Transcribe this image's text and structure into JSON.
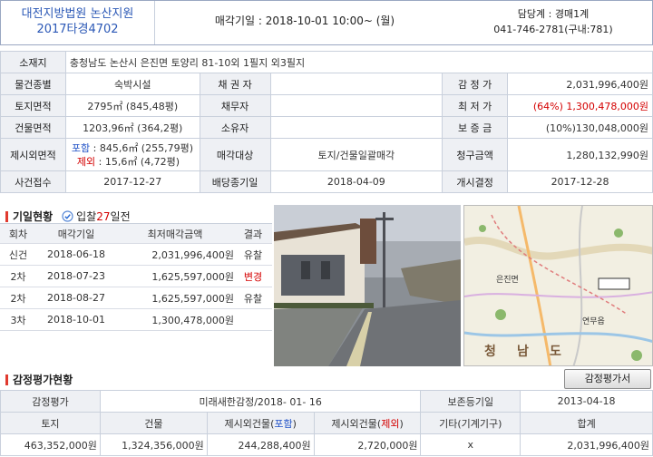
{
  "header": {
    "court": "대전지방법원 논산지원",
    "case_no": "2017타경4702",
    "sale_date": "매각기일 : 2018-10-01   10:00~ (월)",
    "dept": "담당계 : 경매1계",
    "phone": "041-746-2781(구내:781)"
  },
  "info": {
    "addr_label": "소재지",
    "addr": "충청남도 논산시 은진면 토양리 81-10외 1필지",
    "addr_extra": "외3필지",
    "type_label": "물건종별",
    "type": "숙박시설",
    "creditor_label": "채 권 자",
    "creditor": "",
    "appraisal_label": "감 정 가",
    "appraisal": "2,031,996,400원",
    "land_label": "토지면적",
    "land": "2795㎡ (845,48평)",
    "debtor_label": "채무자",
    "debtor": "",
    "min_label": "최 저 가",
    "min": "(64%) 1,300,478,000원",
    "bldg_label": "건물면적",
    "bldg": "1203,96㎡ (364,2평)",
    "owner_label": "소유자",
    "owner": "",
    "deposit_label": "보 증 금",
    "deposit": "(10%)130,048,000원",
    "excl_label": "제시외면적",
    "incl_tag": "포함",
    "incl_val": " : 845,6㎡ (255,79평)",
    "excl_tag": "제외",
    "excl_val": " : 15,6㎡ (4,72평)",
    "target_label": "매각대상",
    "target": "토지/건물일괄매각",
    "claim_label": "청구금액",
    "claim": "1,280,132,990원",
    "filed_label": "사건접수",
    "filed": "2017-12-27",
    "deadline_label": "배당종기일",
    "deadline": "2018-04-09",
    "start_label": "개시결정",
    "start": "2017-12-28"
  },
  "history": {
    "title": "기일현황",
    "badge_pre": "입찰",
    "badge_days": "27",
    "badge_post": "일전",
    "cols": [
      "회차",
      "매각기일",
      "최저매각금액",
      "결과"
    ],
    "rows": [
      {
        "round": "신건",
        "date": "2018-06-18",
        "price": "2,031,996,400원",
        "result": "유찰",
        "red": false
      },
      {
        "round": "2차",
        "date": "2018-07-23",
        "price": "1,625,597,000원",
        "result": "변경",
        "red": true
      },
      {
        "round": "2차",
        "date": "2018-08-27",
        "price": "1,625,597,000원",
        "result": "유찰",
        "red": false
      },
      {
        "round": "3차",
        "date": "2018-10-01",
        "price": "1,300,478,000원",
        "result": "",
        "red": false
      }
    ]
  },
  "map": {
    "labels": [
      "은진면",
      "청",
      "남",
      "도",
      "연무읍"
    ]
  },
  "appraisal": {
    "title": "감정평가현황",
    "button": "감정평가서",
    "head_label": "감정평가",
    "agency": "미래새한감정/2018- 01- 16",
    "keep_label": "보존등기일",
    "keep_date": "2013-04-18",
    "cols": [
      "토지",
      "건물",
      "제시외건물(",
      "포함",
      ")",
      "제시외건물(",
      "제외",
      ")",
      "기타(기계기구)",
      "합계"
    ],
    "vals": [
      "463,352,000원",
      "1,324,356,000원",
      "244,288,400원",
      "2,720,000원",
      "x",
      "2,031,996,400원"
    ]
  }
}
